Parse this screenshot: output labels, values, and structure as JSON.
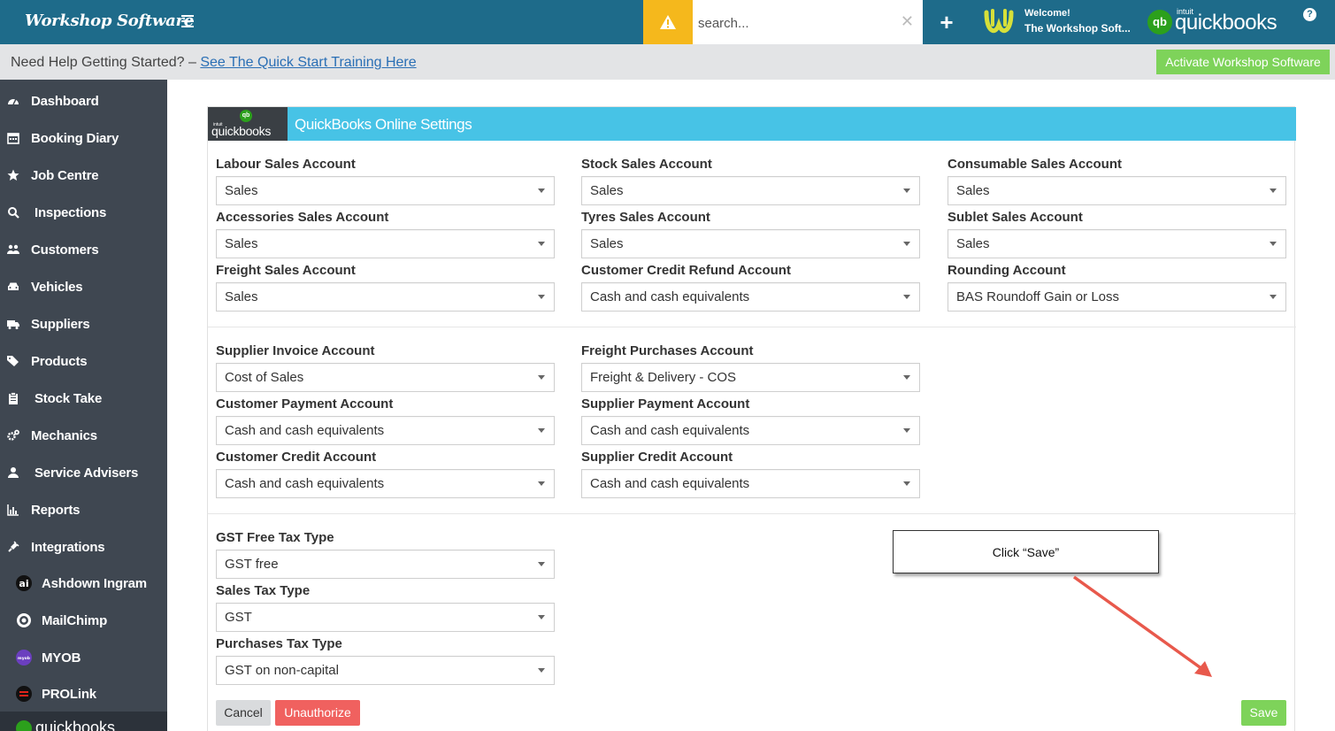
{
  "topbar": {
    "brand": "Workshop Software",
    "search_placeholder": "search...",
    "welcome": "Welcome!",
    "user_name": "The Workshop Soft...",
    "qb_intuit": "intuit",
    "qb_word": "quickbooks",
    "help": "?"
  },
  "helpbar": {
    "prefix": "Need Help Getting Started? – ",
    "link": "See The Quick Start Training Here",
    "activate": "Activate Workshop Software"
  },
  "sidebar": {
    "items": [
      {
        "label": "Dashboard",
        "icon": "dashboard-icon"
      },
      {
        "label": "Booking Diary",
        "icon": "calendar-icon"
      },
      {
        "label": "Job Centre",
        "icon": "star-icon"
      },
      {
        "label": "Inspections",
        "icon": "search-icon"
      },
      {
        "label": "Customers",
        "icon": "users-icon"
      },
      {
        "label": "Vehicles",
        "icon": "car-icon"
      },
      {
        "label": "Suppliers",
        "icon": "truck-icon"
      },
      {
        "label": "Products",
        "icon": "tags-icon"
      },
      {
        "label": "Stock Take",
        "icon": "clipboard-icon"
      },
      {
        "label": "Mechanics",
        "icon": "gears-icon"
      },
      {
        "label": "Service Advisers",
        "icon": "user-icon"
      },
      {
        "label": "Reports",
        "icon": "bar-chart-icon"
      },
      {
        "label": "Integrations",
        "icon": "plug-icon"
      }
    ],
    "integrations": [
      {
        "label": "Ashdown Ingram",
        "icon": "ashdown-ingram-logo-icon"
      },
      {
        "label": "MailChimp",
        "icon": "mailchimp-logo-icon"
      },
      {
        "label": "MYOB",
        "icon": "myob-logo-icon"
      },
      {
        "label": "PROLink",
        "icon": "prolink-logo-icon"
      }
    ]
  },
  "panel": {
    "logo_intuit": "intuit",
    "logo_word": "quickbooks",
    "logo_badge": "qb",
    "title": "QuickBooks Online Settings",
    "sales_fields": [
      {
        "label": "Labour Sales Account",
        "value": "Sales"
      },
      {
        "label": "Stock Sales Account",
        "value": "Sales"
      },
      {
        "label": "Consumable Sales Account",
        "value": "Sales"
      },
      {
        "label": "Accessories Sales Account",
        "value": "Sales"
      },
      {
        "label": "Tyres Sales Account",
        "value": "Sales"
      },
      {
        "label": "Sublet Sales Account",
        "value": "Sales"
      },
      {
        "label": "Freight Sales Account",
        "value": "Sales"
      },
      {
        "label": "Customer Credit Refund Account",
        "value": "Cash and cash equivalents"
      },
      {
        "label": "Rounding Account",
        "value": "BAS Roundoff Gain or Loss"
      }
    ],
    "payment_fields": [
      {
        "label": "Supplier Invoice Account",
        "value": "Cost of Sales"
      },
      {
        "label": "Freight Purchases Account",
        "value": "Freight & Delivery - COS"
      },
      {
        "label": "Customer Payment Account",
        "value": "Cash and cash equivalents"
      },
      {
        "label": "Supplier Payment Account",
        "value": "Cash and cash equivalents"
      },
      {
        "label": "Customer Credit Account",
        "value": "Cash and cash equivalents"
      },
      {
        "label": "Supplier Credit Account",
        "value": "Cash and cash equivalents"
      }
    ],
    "tax_fields": [
      {
        "label": "GST Free Tax Type",
        "value": "GST free"
      },
      {
        "label": "Sales Tax Type",
        "value": "GST"
      },
      {
        "label": "Purchases Tax Type",
        "value": "GST on non-capital"
      }
    ]
  },
  "buttons": {
    "cancel": "Cancel",
    "unauthorize": "Unauthorize",
    "save": "Save"
  },
  "annotation": {
    "callout": "Click “Save”",
    "arrow_color": "#e8594c"
  },
  "colors": {
    "topbar": "#1e6b8a",
    "panel_header": "#47c3e6",
    "sidebar": "#3f4751",
    "save_green": "#7ed35a",
    "unauthorize_red": "#f0615f",
    "warning": "#f5b81c"
  }
}
